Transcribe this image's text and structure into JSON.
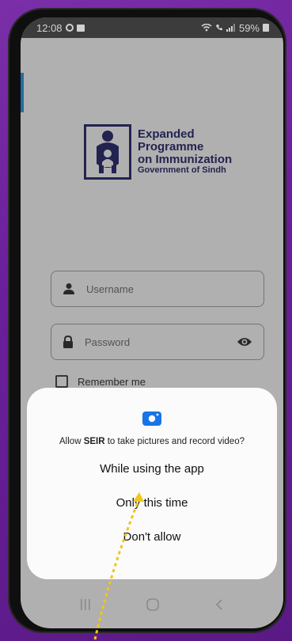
{
  "status_bar": {
    "time": "12:08",
    "battery": "59%"
  },
  "logo": {
    "line1": "Expanded",
    "line2": "Programme",
    "line3": "on Immunization",
    "line4": "Government of Sindh",
    "color": "#2b2b63"
  },
  "login": {
    "username_placeholder": "Username",
    "password_placeholder": "Password",
    "remember_label": "Remember me"
  },
  "permission_dialog": {
    "prompt_prefix": "Allow ",
    "app_name": "SEIR",
    "prompt_suffix": " to take pictures and record video?",
    "options": [
      "While using the app",
      "Only this time",
      "Don't allow"
    ],
    "camera_icon": "camera-icon",
    "accent_color": "#1a73e8"
  },
  "annotation": {
    "arrow_color": "#f5c518"
  }
}
